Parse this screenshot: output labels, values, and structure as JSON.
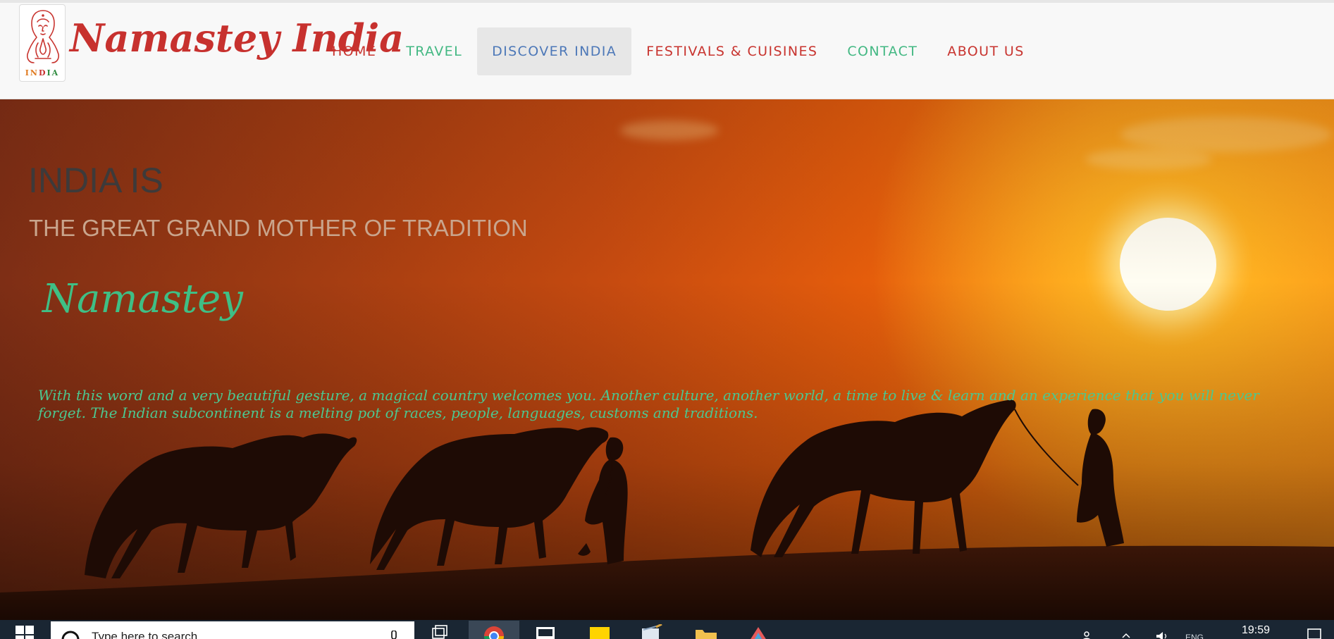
{
  "site": {
    "brand_name": "Namastey India",
    "logo_word_parts": [
      "IN",
      "D",
      "IA"
    ]
  },
  "nav": {
    "items": [
      {
        "label": "HOME",
        "color": "#c8342f",
        "active": false
      },
      {
        "label": "TRAVEL",
        "color": "#43b883",
        "active": false
      },
      {
        "label": "DISCOVER INDIA",
        "color": "#4d78b8",
        "active": true
      },
      {
        "label": "FESTIVALS & CUISINES",
        "color": "#c8342f",
        "active": false
      },
      {
        "label": "CONTACT",
        "color": "#43b883",
        "active": false
      },
      {
        "label": "ABOUT US",
        "color": "#c8342f",
        "active": false
      }
    ]
  },
  "hero": {
    "title": "INDIA IS",
    "subtitle": "THE GREAT GRAND MOTHER OF TRADITION",
    "greeting": "Namastey",
    "description": "With this word and a very beautiful gesture, a magical country welcomes you. Another culture, another world, a time to live & learn and an experience that you will never forget. The Indian subcontinent is a melting pot of races, people, languages, customs and traditions."
  },
  "taskbar": {
    "search_placeholder": "Type here to search",
    "clock": "19:59",
    "language": "ENG",
    "apps": [
      "task-view-icon",
      "chrome-icon",
      "terminal-icon",
      "sticky-notes-icon",
      "notepad-icon",
      "file-explorer-icon",
      "paint-icon"
    ]
  },
  "colors": {
    "brand": "#c7312e",
    "accent_green": "#43b883",
    "accent_blue": "#4d78b8",
    "header_bg": "#f8f8f8",
    "taskbar_bg": "#1a2633"
  }
}
